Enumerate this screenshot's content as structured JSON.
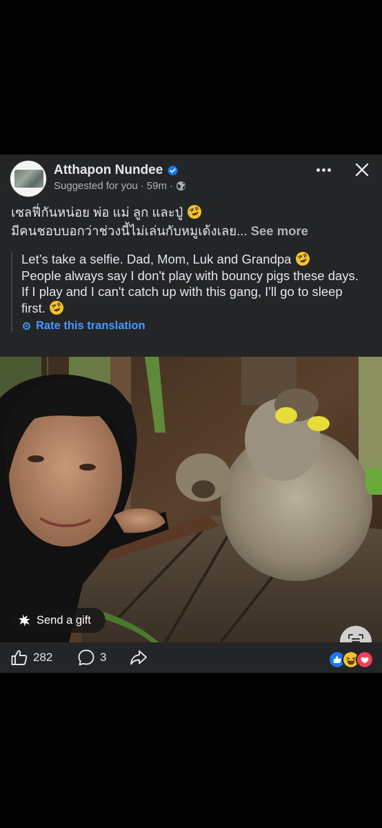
{
  "post": {
    "author": "Atthapon Nundee",
    "meta_suggested": "Suggested for you",
    "meta_sep1": "·",
    "meta_time": "59m",
    "meta_sep2": "·",
    "original_line1": "เซลฟี่กันหน่อย พ่อ แม่ ลูก และปู่",
    "original_line2": "มีคนชอบบอกว่าช่วงนี้ไม่เล่นกับหมูเด้งเลย...",
    "see_more": "See more",
    "translation_line1": "Let’s take a selfie. Dad, Mom, Luk and Grandpa",
    "translation_line2": "People always say I don't play with bouncy pigs these days.",
    "translation_line3": "If I play and I can't catch up with this gang, I'll go to sleep first.",
    "rate_translation": "Rate this translation",
    "send_gift": "Send a gift",
    "likes": "282",
    "comments": "3"
  },
  "icons": {
    "verified": "verified-badge-icon",
    "globe": "globe-icon",
    "more": "more-options-icon",
    "close": "close-icon",
    "gear": "gear-icon",
    "gift": "gift-icon",
    "scan": "text-scan-icon",
    "like": "like-icon",
    "comment": "comment-icon",
    "share": "share-icon",
    "emoji": "rolling-laughing-emoji",
    "reactions": [
      "like-reaction-icon",
      "haha-reaction-icon",
      "love-reaction-icon"
    ]
  },
  "colors": {
    "card_bg": "#242526",
    "page_bg": "#000000",
    "link_blue": "#4599ff",
    "verified_blue": "#1877f2",
    "text_primary": "#e4e6eb",
    "text_secondary": "#b0b3b8"
  }
}
